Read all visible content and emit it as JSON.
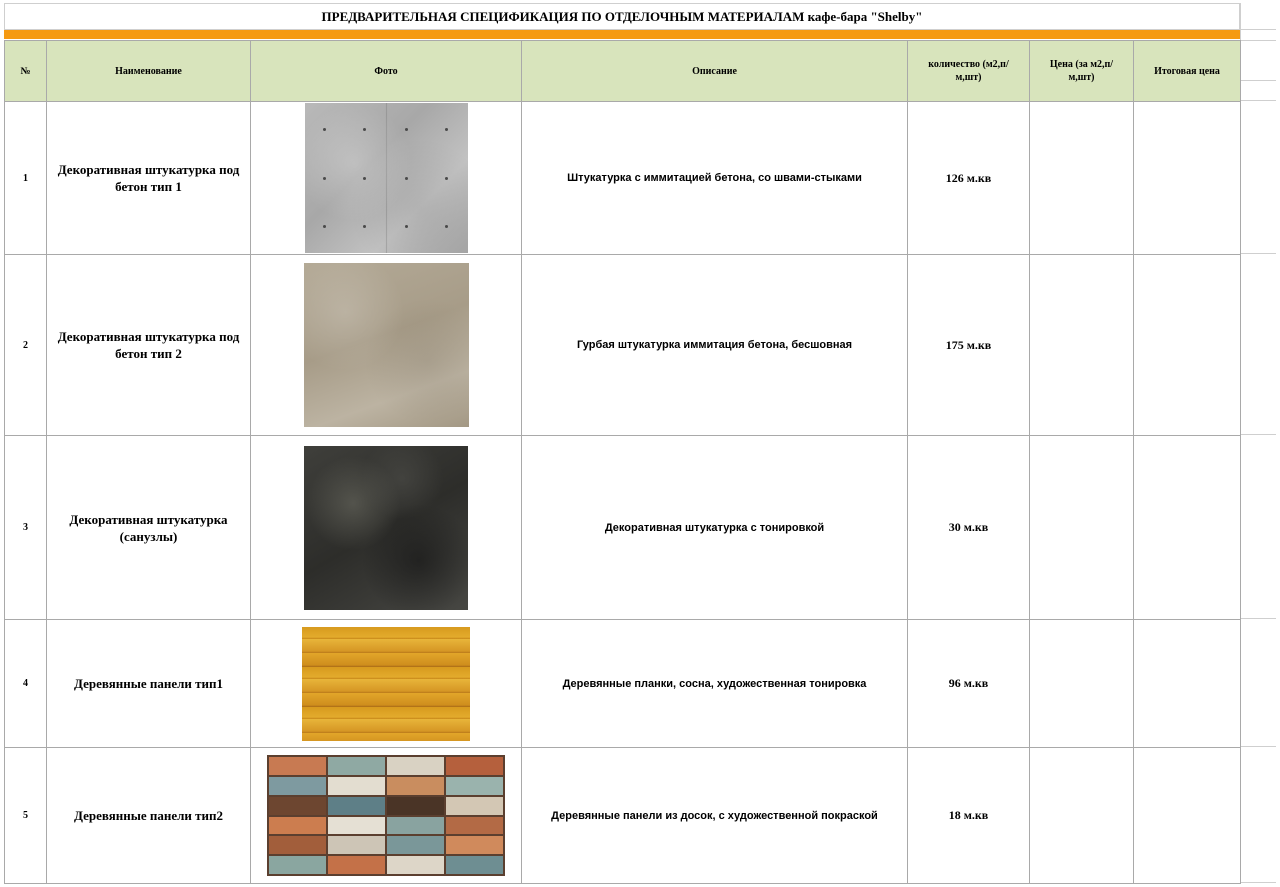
{
  "title": "ПРЕДВАРИТЕЛЬНАЯ СПЕЦИФИКАЦИЯ ПО ОТДЕЛОЧНЫМ МАТЕРИАЛАМ кафе-бара \"Shelby\"",
  "colors": {
    "accent_bar": "#f59a12",
    "header_bg": "#d8e4bc"
  },
  "headers": {
    "num": "№",
    "name": "Наименование",
    "photo": "Фото",
    "desc": "Описание",
    "qty": "количество (м2,п/м,шт)",
    "price": "Цена (за м2,п/м,шт)",
    "total": "Итоговая цена"
  },
  "rows": [
    {
      "num": "1",
      "name": "Декоративная штукатурка под бетон тип 1",
      "photo": "concrete-panel-texture",
      "desc": "Штукатурка с иммитацией бетона, со швами-стыками",
      "qty": "126 м.кв",
      "price": "",
      "total": ""
    },
    {
      "num": "2",
      "name": "Декоративная штукатурка под бетон тип 2",
      "photo": "beige-concrete-texture",
      "desc": "Гурбая штукатурка иммитация бетона, бесшовная",
      "qty": "175 м.кв",
      "price": "",
      "total": ""
    },
    {
      "num": "3",
      "name": "Декоративная штукатурка (санузлы)",
      "photo": "dark-plaster-texture",
      "desc": "Декоративная штукатурка с тонировкой",
      "qty": "30 м.кв",
      "price": "",
      "total": ""
    },
    {
      "num": "4",
      "name": "Деревянные панели тип1",
      "photo": "yellow-wood-planks-texture",
      "desc": "Деревянные планки, сосна, художественная тонировка",
      "qty": "96 м.кв",
      "price": "",
      "total": ""
    },
    {
      "num": "5",
      "name": "Деревянные панели тип2",
      "photo": "painted-wood-bricks-texture",
      "desc": "Деревянные панели из досок, с художественной покраской",
      "qty": "18 м.кв",
      "price": "",
      "total": ""
    }
  ]
}
